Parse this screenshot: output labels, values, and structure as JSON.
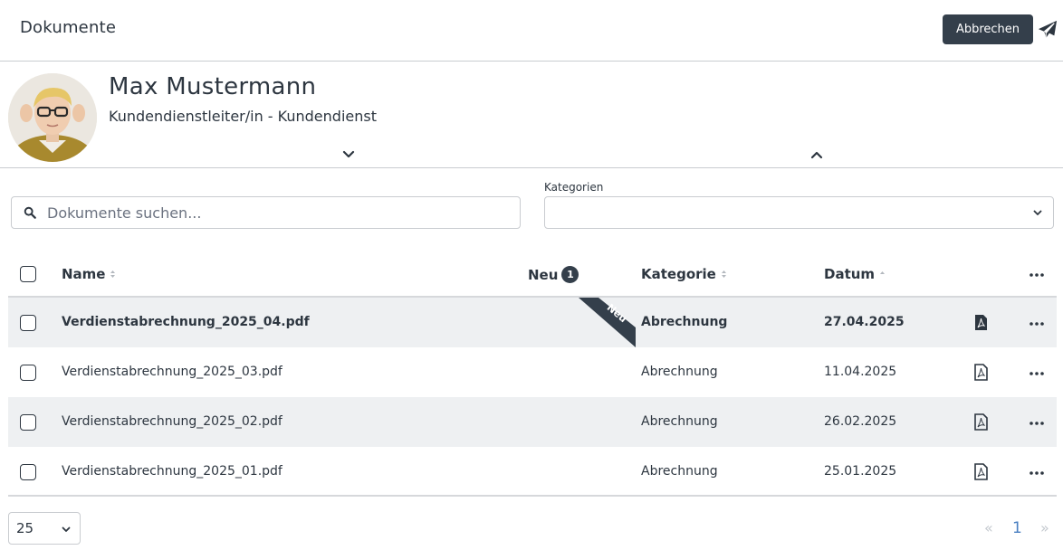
{
  "header": {
    "title": "Dokumente",
    "cancel_label": "Abbrechen"
  },
  "profile": {
    "name": "Max Mustermann",
    "role": "Kundendienstleiter/in - Kundendienst"
  },
  "search": {
    "placeholder": "Dokumente suchen...",
    "value": ""
  },
  "category": {
    "label": "Kategorien",
    "value": ""
  },
  "table": {
    "columns": {
      "name": "Name",
      "new": "Neu",
      "new_count": "1",
      "category": "Kategorie",
      "date": "Datum"
    },
    "ribbon_label": "Neu",
    "rows": [
      {
        "name": "Verdienstabrechnung_2025_04.pdf",
        "category": "Abrechnung",
        "date": "27.04.2025",
        "is_new": true
      },
      {
        "name": "Verdienstabrechnung_2025_03.pdf",
        "category": "Abrechnung",
        "date": "11.04.2025",
        "is_new": false
      },
      {
        "name": "Verdienstabrechnung_2025_02.pdf",
        "category": "Abrechnung",
        "date": "26.02.2025",
        "is_new": false
      },
      {
        "name": "Verdienstabrechnung_2025_01.pdf",
        "category": "Abrechnung",
        "date": "25.01.2025",
        "is_new": false
      }
    ]
  },
  "pagination": {
    "page_size": "25",
    "prev": "«",
    "current": "1",
    "next": "»"
  },
  "colors": {
    "dark": "#343f4b",
    "row_shade": "#eef0f2",
    "border": "#c9ccd0",
    "link": "#4a7fc1"
  },
  "icons": {
    "send": "paper-plane-icon",
    "search": "search-icon",
    "file": "pdf-file-icon",
    "more": "ellipsis-icon"
  }
}
